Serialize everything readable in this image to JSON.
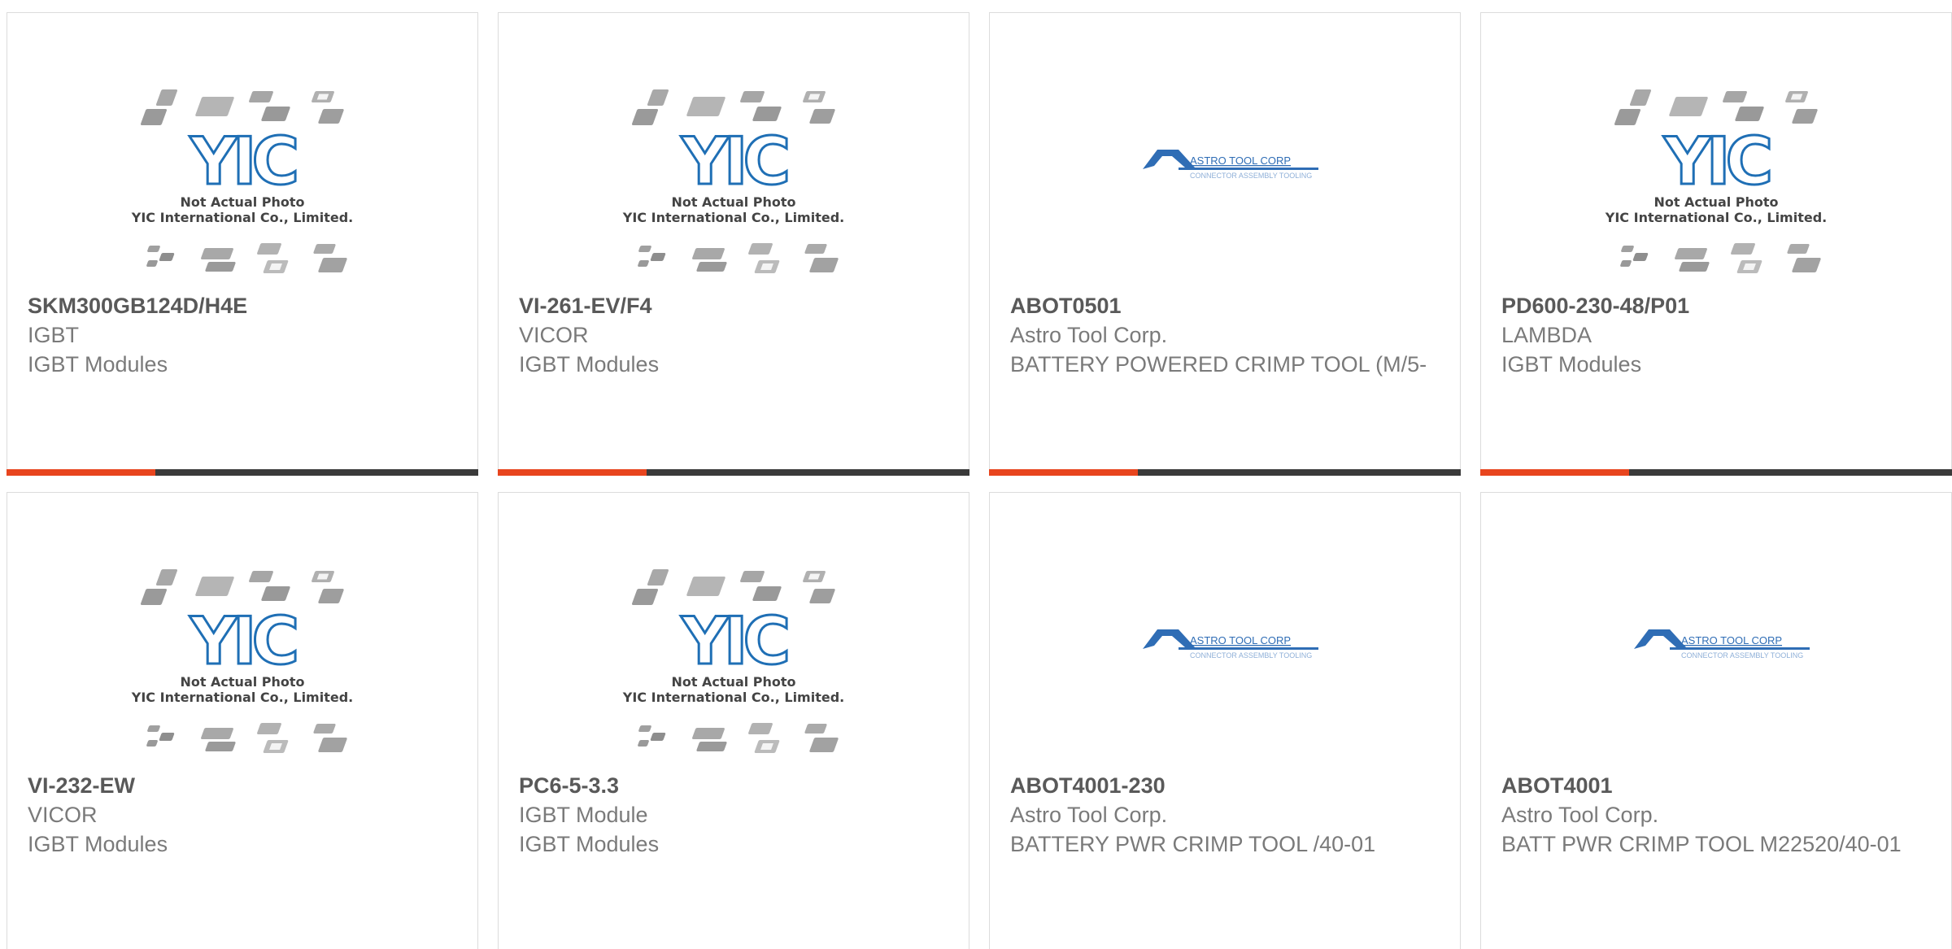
{
  "theme": {
    "accent": "#e8451e",
    "bar": "#3a3a3a",
    "yic_blue": "#1f6fb5",
    "astro_blue": "#2f6db5"
  },
  "placeholder": {
    "line1": "Not Actual Photo",
    "line2": "YIC International Co., Limited.",
    "brand": "YIC"
  },
  "astro_logo": {
    "name": "ASTRO TOOL CORP",
    "tagline": "CONNECTOR ASSEMBLY TOOLING"
  },
  "products": [
    {
      "part": "SKM300GB124D/H4E",
      "manufacturer": "IGBT",
      "description": "IGBT Modules",
      "image": "yic-placeholder"
    },
    {
      "part": "VI-261-EV/F4",
      "manufacturer": "VICOR",
      "description": "IGBT Modules",
      "image": "yic-placeholder"
    },
    {
      "part": "ABOT0501",
      "manufacturer": "Astro Tool Corp.",
      "description": "BATTERY POWERED CRIMP TOOL (M/5-",
      "image": "astro-logo"
    },
    {
      "part": "PD600-230-48/P01",
      "manufacturer": "LAMBDA",
      "description": "IGBT Modules",
      "image": "yic-placeholder"
    },
    {
      "part": "VI-232-EW",
      "manufacturer": "VICOR",
      "description": "IGBT Modules",
      "image": "yic-placeholder"
    },
    {
      "part": "PC6-5-3.3",
      "manufacturer": "IGBT Module",
      "description": "IGBT Modules",
      "image": "yic-placeholder"
    },
    {
      "part": "ABOT4001-230",
      "manufacturer": "Astro Tool Corp.",
      "description": "BATTERY PWR CRIMP TOOL /40-01",
      "image": "astro-logo"
    },
    {
      "part": "ABOT4001",
      "manufacturer": "Astro Tool Corp.",
      "description": "BATT PWR CRIMP TOOL M22520/40-01",
      "image": "astro-logo"
    }
  ]
}
